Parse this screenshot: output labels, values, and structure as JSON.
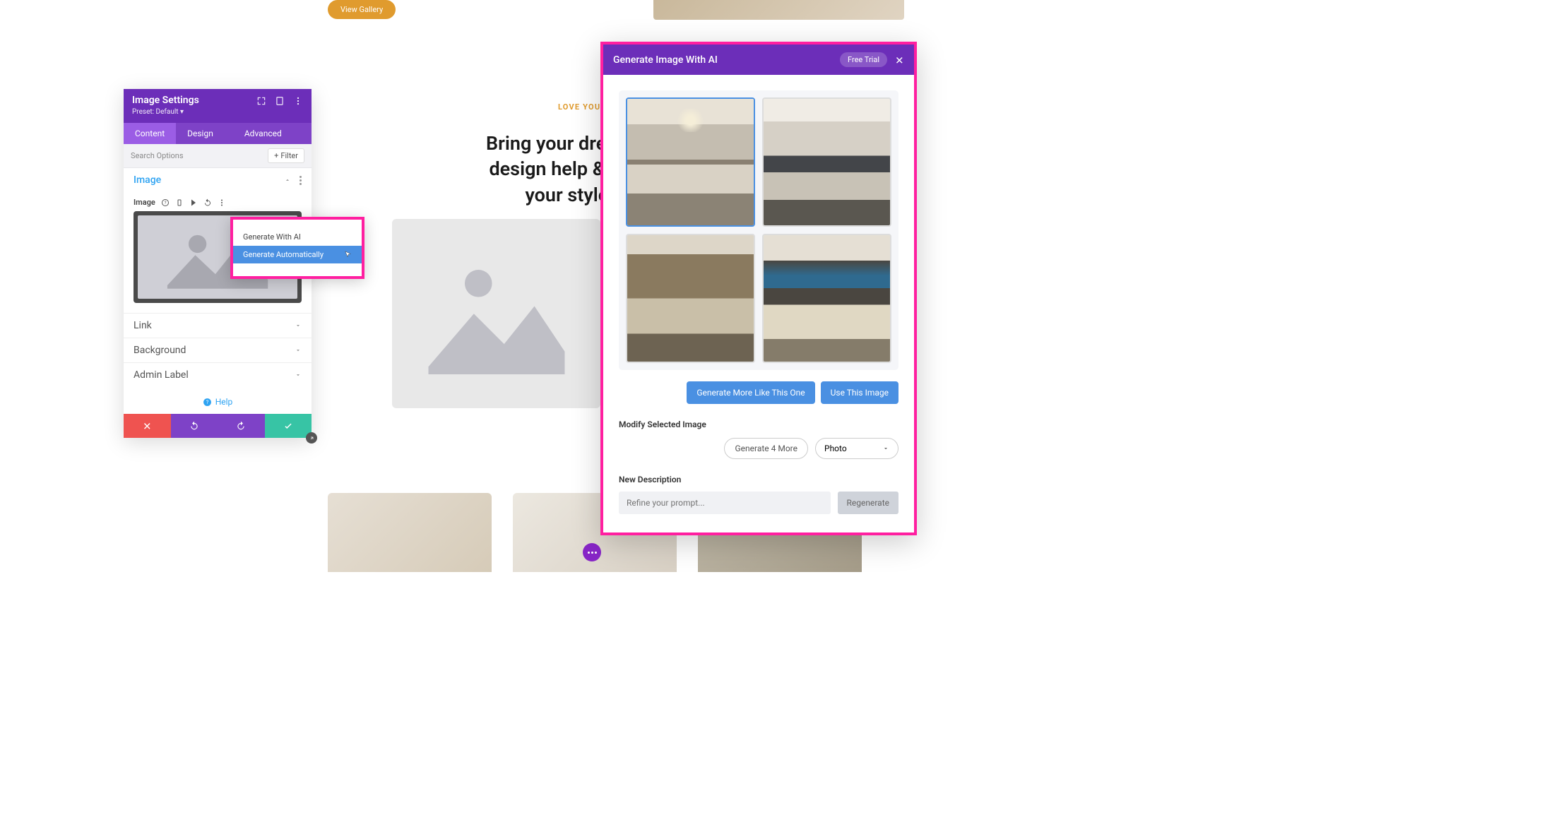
{
  "background": {
    "view_gallery": "View Gallery",
    "tagline": "LOVE YOUR S",
    "heading": "Bring your dream home to\ndesign help & hand-picke\nyour style, space"
  },
  "settings": {
    "title": "Image Settings",
    "preset": "Preset: Default ▾",
    "tabs": {
      "content": "Content",
      "design": "Design",
      "advanced": "Advanced"
    },
    "search_placeholder": "Search Options",
    "filter": "Filter",
    "sections": {
      "image": "Image",
      "image_label": "Image",
      "link": "Link",
      "background": "Background",
      "admin": "Admin Label"
    },
    "help": "Help"
  },
  "context_menu": {
    "with_ai": "Generate With AI",
    "auto": "Generate Automatically"
  },
  "ai_modal": {
    "title": "Generate Image With AI",
    "trial": "Free Trial",
    "gen_more_like": "Generate More Like This One",
    "use_image": "Use This Image",
    "modify_label": "Modify Selected Image",
    "gen_4_more": "Generate 4 More",
    "style_select": "Photo",
    "new_desc": "New Description",
    "prompt_placeholder": "Refine your prompt...",
    "regenerate": "Regenerate"
  }
}
